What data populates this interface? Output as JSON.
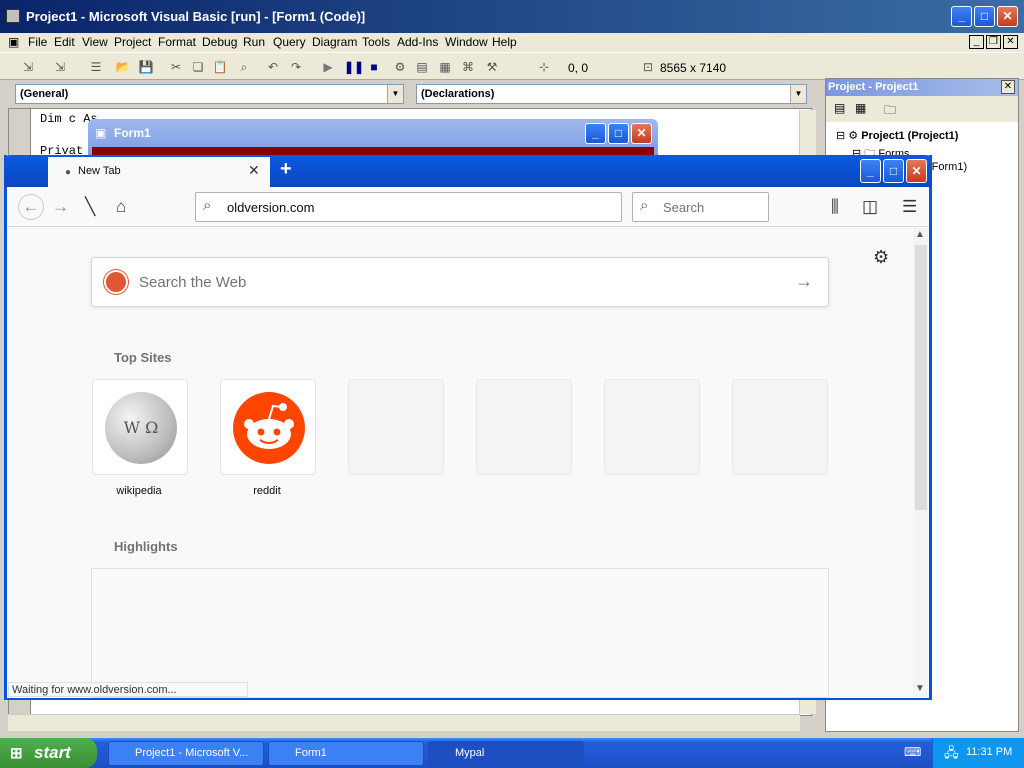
{
  "vb": {
    "title": "Project1 - Microsoft Visual Basic [run] - [Form1 (Code)]",
    "menu": [
      "File",
      "Edit",
      "View",
      "Project",
      "Format",
      "Debug",
      "Run",
      "Query",
      "Diagram",
      "Tools",
      "Add-Ins",
      "Window",
      "Help"
    ],
    "position": "0, 0",
    "size": "8565 x 7140",
    "object_combo": "(General)",
    "proc_combo": "(Declarations)",
    "code_lines": [
      "Dim c As",
      "Privat"
    ]
  },
  "project": {
    "title": "Project - Project1",
    "root": "Project1 (Project1)",
    "forms_folder": "Forms",
    "form_item": "(Form1)"
  },
  "form1": {
    "title": "Form1"
  },
  "browser": {
    "tab_label": "New Tab",
    "url": "oldversion.com",
    "search_placeholder": "Search",
    "web_search_placeholder": "Search the Web",
    "top_sites_title": "Top Sites",
    "highlights_title": "Highlights",
    "sites": [
      {
        "label": "wikipedia",
        "icon": "wikipedia-globe-icon"
      },
      {
        "label": "reddit",
        "icon": "reddit-alien-icon"
      }
    ],
    "status": "Waiting for www.oldversion.com..."
  },
  "taskbar": {
    "start_label": "start",
    "items": [
      "Project1 - Microsoft V...",
      "Form1",
      "Mypal"
    ],
    "clock": "11:31 PM"
  },
  "colors": {
    "xp_blue": "#0054e3",
    "reddit_orange": "#ff4500",
    "form_body_red": "#8b0000"
  }
}
